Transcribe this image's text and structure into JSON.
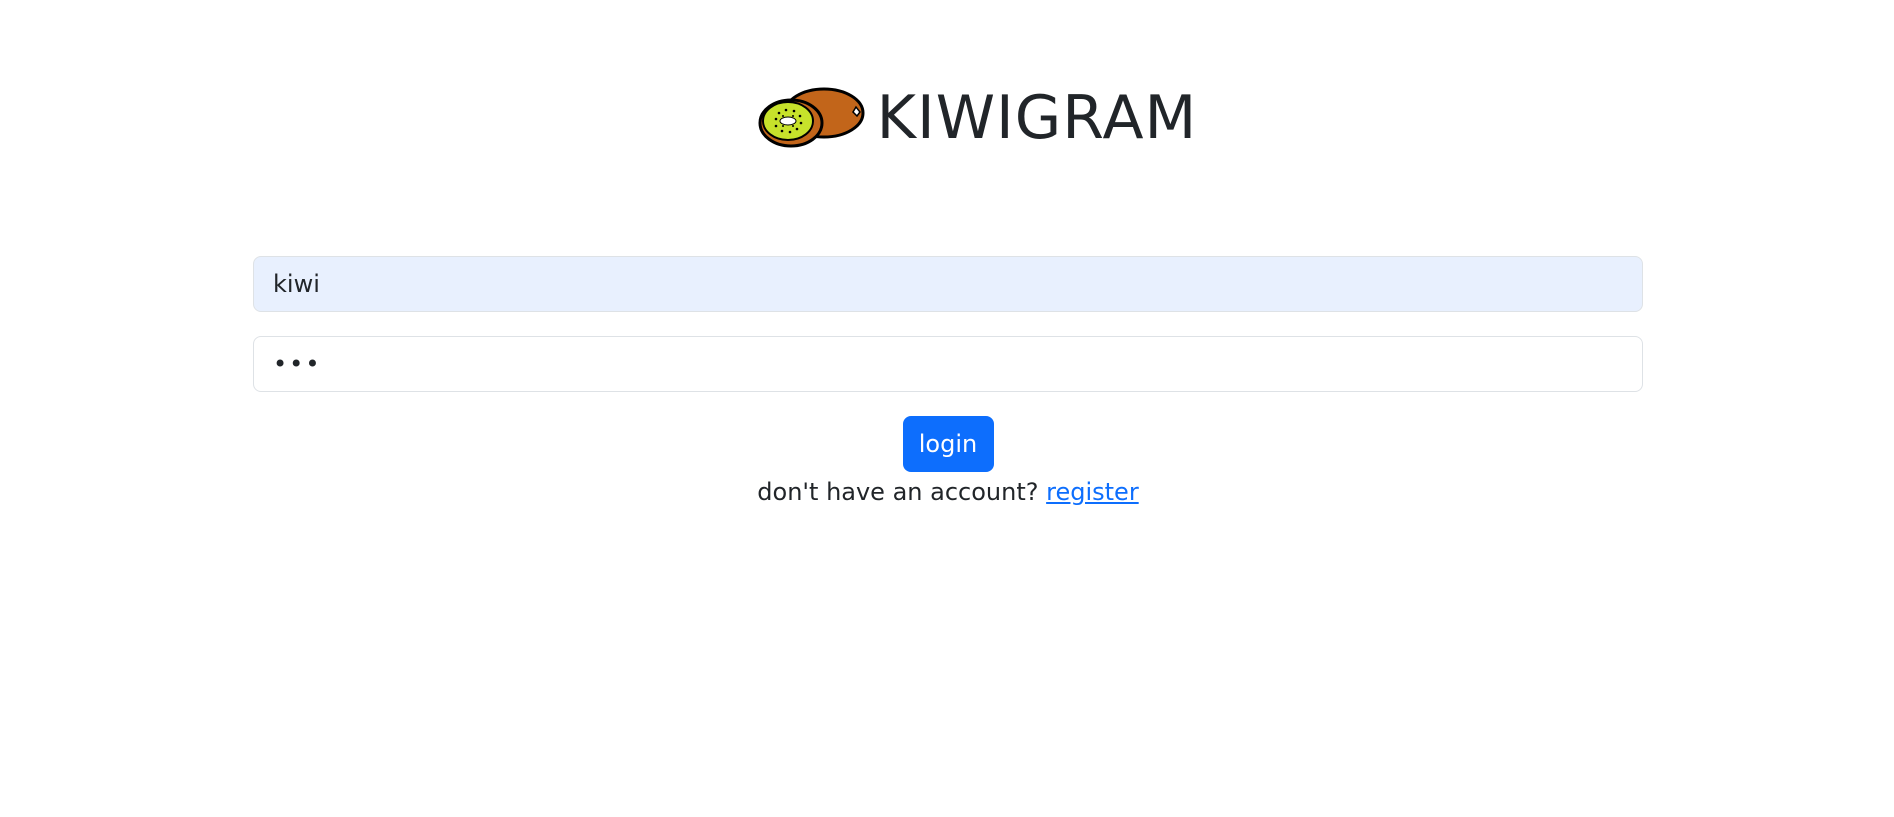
{
  "header": {
    "title": "KIWIGRAM",
    "logo_icon": "kiwi-fruit-icon"
  },
  "login_form": {
    "username_value": "kiwi",
    "password_value": "abc",
    "login_label": "login",
    "register_prompt": "don't have an account?",
    "register_link_label": "register"
  },
  "colors": {
    "primary": "#0d6efd",
    "autofill_bg": "#e8f0fe",
    "text": "#212529",
    "border": "#dee2e6",
    "kiwi_skin": "#c2651a",
    "kiwi_flesh": "#c7e22b"
  }
}
